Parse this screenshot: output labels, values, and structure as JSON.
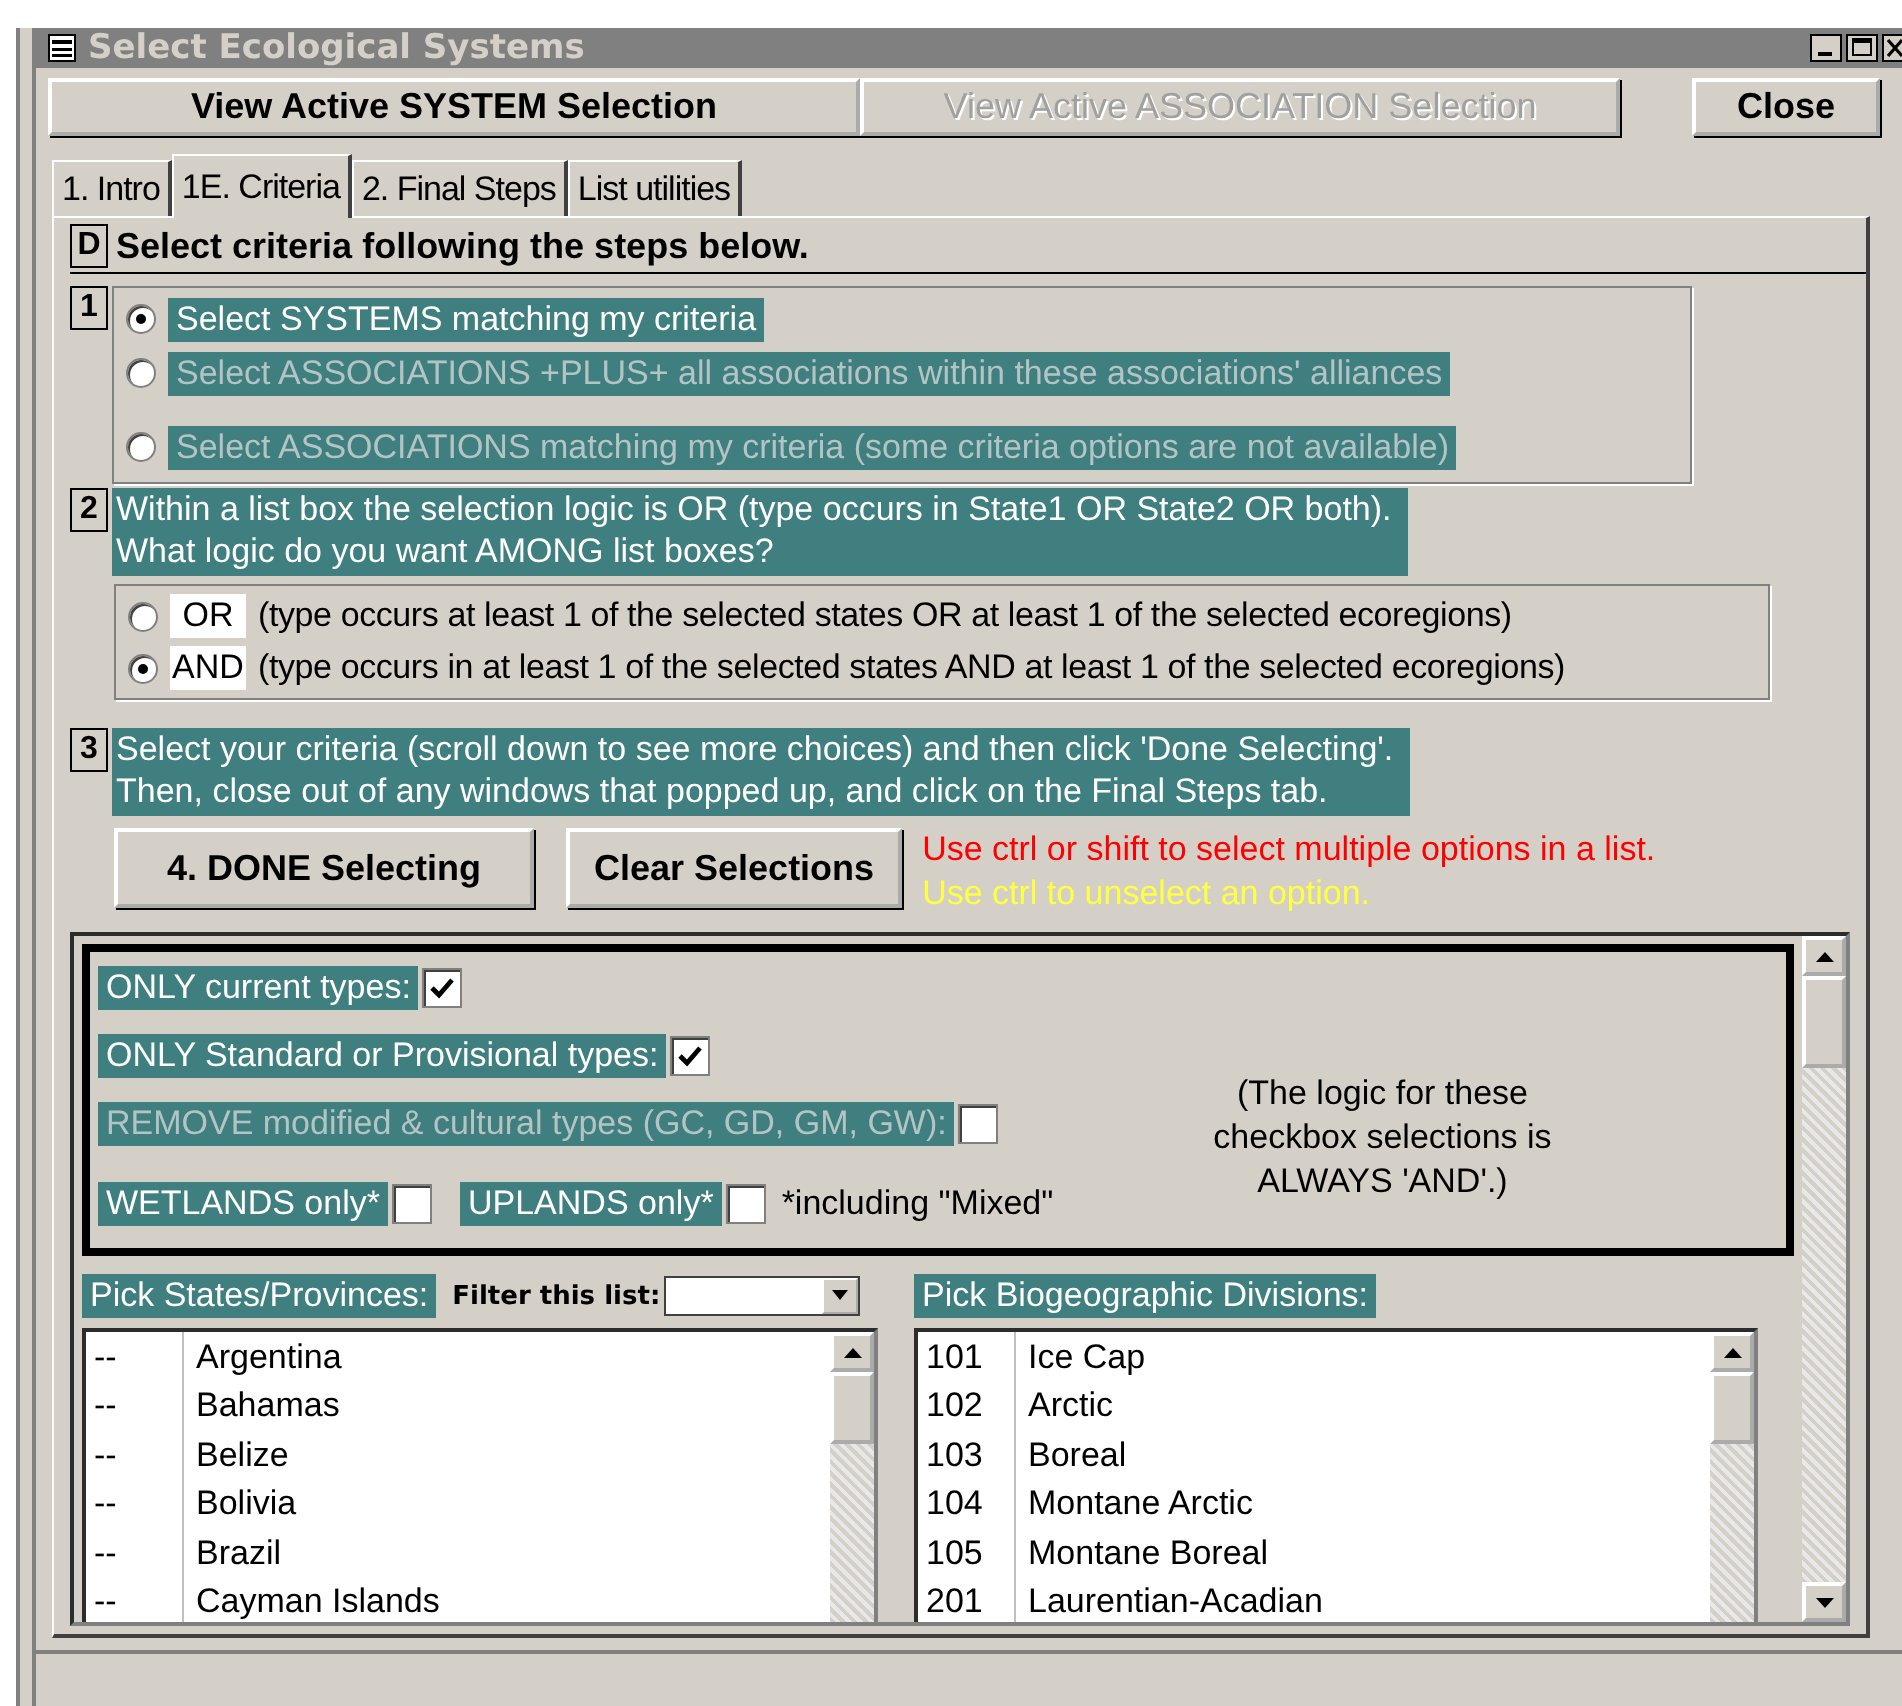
{
  "window": {
    "title": "Select Ecological Systems"
  },
  "top_buttons": [
    {
      "label": "View Active SYSTEM Selection",
      "disabled": false
    },
    {
      "label": "View Active ASSOCIATION Selection",
      "disabled": true
    },
    {
      "label": "Close",
      "disabled": false
    }
  ],
  "tabs": [
    {
      "label": "1. Intro",
      "selected": false
    },
    {
      "label": "1E. Criteria",
      "selected": true
    },
    {
      "label": "2. Final Steps",
      "selected": false
    },
    {
      "label": "List utilities",
      "selected": false
    }
  ],
  "header": {
    "badge": "D",
    "text": "Select criteria following the steps below."
  },
  "step1": {
    "number": "1",
    "options": [
      {
        "label": "Select SYSTEMS matching my criteria",
        "selected": true,
        "disabled": false
      },
      {
        "label": "Select ASSOCIATIONS +PLUS+ all associations within these associations' alliances",
        "selected": false,
        "disabled": true
      },
      {
        "label": "Select ASSOCIATIONS matching my criteria (some criteria options are not available)",
        "selected": false,
        "disabled": true
      }
    ]
  },
  "step2": {
    "number": "2",
    "lines": [
      "Within a list box the selection logic is OR (type occurs in State1 OR State2 OR both).",
      "What logic do you want AMONG list boxes?"
    ],
    "options": [
      {
        "label": "OR",
        "description": "(type occurs at least 1 of the selected states OR at least 1 of the selected ecoregions)",
        "selected": false
      },
      {
        "label": "AND",
        "description": "(type occurs in at least 1 of the selected states AND at least 1 of the selected ecoregions)",
        "selected": true
      }
    ]
  },
  "step3": {
    "number": "3",
    "lines": [
      "Select your criteria (scroll down to see more choices) and then click 'Done Selecting'.",
      "Then, close out of any windows that popped up, and click on the Final Steps tab."
    ]
  },
  "actions": [
    "4. DONE Selecting",
    "Clear Selections"
  ],
  "hints": [
    {
      "text": "Use ctrl or shift to select multiple options in a list.",
      "color": "#ff0000"
    },
    {
      "text": "Use ctrl to unselect an option.",
      "color": "#ffff40"
    }
  ],
  "checkbox_rows": [
    {
      "items": [
        {
          "label": "ONLY current types:",
          "checked": true,
          "disabled": false
        }
      ]
    },
    {
      "items": [
        {
          "label": "ONLY Standard or Provisional types:",
          "checked": true,
          "disabled": false
        }
      ]
    },
    {
      "items": [
        {
          "label": "REMOVE modified & cultural types (GC, GD, GM, GW):",
          "checked": false,
          "disabled": true
        }
      ]
    },
    {
      "items": [
        {
          "label": "WETLANDS only*",
          "checked": false,
          "disabled": false
        },
        {
          "label": "UPLANDS only*",
          "checked": false,
          "disabled": false
        }
      ],
      "note": "*including \"Mixed\""
    }
  ],
  "logic_note": [
    "(The logic for these",
    "checkbox selections is",
    "ALWAYS  'AND'.)"
  ],
  "states_list": {
    "label": "Pick States/Provinces:",
    "filter_label": "Filter this list:",
    "rows": [
      {
        "code": "--",
        "name": "Argentina"
      },
      {
        "code": "--",
        "name": "Bahamas"
      },
      {
        "code": "--",
        "name": "Belize"
      },
      {
        "code": "--",
        "name": "Bolivia"
      },
      {
        "code": "--",
        "name": "Brazil"
      },
      {
        "code": "--",
        "name": "Cayman Islands"
      }
    ]
  },
  "divisions_list": {
    "label": "Pick Biogeographic Divisions:",
    "rows": [
      {
        "code": "101",
        "name": "Ice Cap"
      },
      {
        "code": "102",
        "name": "Arctic"
      },
      {
        "code": "103",
        "name": "Boreal"
      },
      {
        "code": "104",
        "name": "Montane Arctic"
      },
      {
        "code": "105",
        "name": "Montane Boreal"
      },
      {
        "code": "201",
        "name": "Laurentian-Acadian"
      }
    ]
  }
}
